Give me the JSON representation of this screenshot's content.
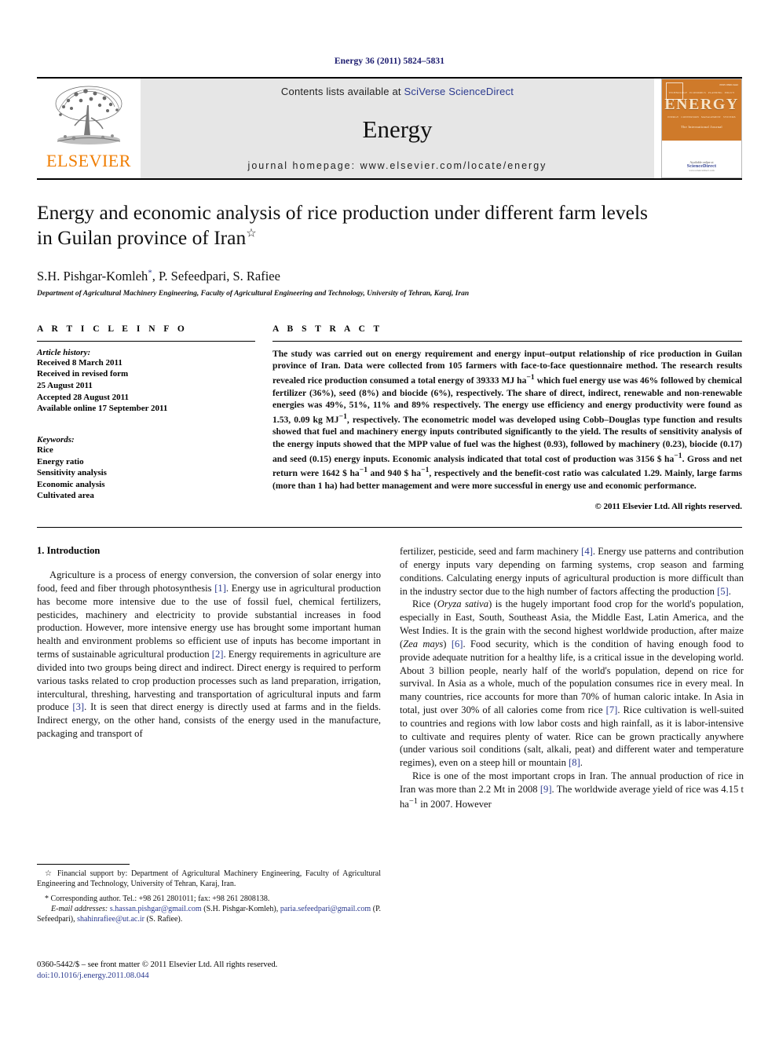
{
  "running_head": "Energy 36 (2011) 5824–5831",
  "header": {
    "publisher_name": "ELSEVIER",
    "contents_prefix": "Contents lists available at ",
    "contents_link": "SciVerse ScienceDirect",
    "journal_name": "Energy",
    "homepage": "journal homepage: www.elsevier.com/locate/energy",
    "cover": {
      "title": "ENERGY",
      "subtitle": "The International Journal",
      "band_terms": [
        "TECHNOLOGY",
        "ECONOMICS",
        "PLANNING",
        "POLICY"
      ],
      "band_terms2": [
        "ENERGY",
        "CONVERSION",
        "MANAGEMENT",
        "SYSTEMS"
      ],
      "available_text": "Available online at",
      "sciencedirect": "ScienceDirect",
      "url": "www.sciencedirect.com",
      "corner_code": "ISSN 0360-5442"
    }
  },
  "article": {
    "title": "Energy and economic analysis of rice production under different farm levels in Guilan province of Iran",
    "title_star": "☆",
    "authors": "S.H. Pishgar-Komleh, P. Sefeedpari, S. Rafiee",
    "author_star": "*",
    "affiliation": "Department of Agricultural Machinery Engineering, Faculty of Agricultural Engineering and Technology, University of Tehran, Karaj, Iran"
  },
  "info": {
    "heading": "A R T I C L E   I N F O",
    "history_label": "Article history:",
    "history": [
      "Received 8 March 2011",
      "Received in revised form",
      "25 August 2011",
      "Accepted 28 August 2011",
      "Available online 17 September 2011"
    ],
    "keywords_label": "Keywords:",
    "keywords": [
      "Rice",
      "Energy ratio",
      "Sensitivity analysis",
      "Economic analysis",
      "Cultivated area"
    ]
  },
  "abstract": {
    "heading": "A B S T R A C T",
    "text": "The study was carried out on energy requirement and energy input–output relationship of rice production in Guilan province of Iran. Data were collected from 105 farmers with face-to-face questionnaire method. The research results revealed rice production consumed a total energy of 39333 MJ ha−1 which fuel energy use was 46% followed by chemical fertilizer (36%), seed (8%) and biocide (6%), respectively. The share of direct, indirect, renewable and non-renewable energies was 49%, 51%, 11% and 89% respectively. The energy use efficiency and energy productivity were found as 1.53, 0.09 kg MJ−1, respectively. The econometric model was developed using Cobb–Douglas type function and results showed that fuel and machinery energy inputs contributed significantly to the yield. The results of sensitivity analysis of the energy inputs showed that the MPP value of fuel was the highest (0.93), followed by machinery (0.23), biocide (0.17) and seed (0.15) energy inputs. Economic analysis indicated that total cost of production was 3156 $ ha−1. Gross and net return were 1642 $ ha−1 and 940 $ ha−1, respectively and the benefit-cost ratio was calculated 1.29. Mainly, large farms (more than 1 ha) had better management and were more successful in energy use and economic performance.",
    "copyright": "© 2011 Elsevier Ltd. All rights reserved."
  },
  "body": {
    "section_number_title": "1.  Introduction",
    "left_paragraph_1": "Agriculture is a process of energy conversion, the conversion of solar energy into food, feed and fiber through photosynthesis [1]. Energy use in agricultural production has become more intensive due to the use of fossil fuel, chemical fertilizers, pesticides, machinery and electricity to provide substantial increases in food production. However, more intensive energy use has brought some important human health and environment problems so efficient use of inputs has become important in terms of sustainable agricultural production [2]. Energy requirements in agriculture are divided into two groups being direct and indirect. Direct energy is required to perform various tasks related to crop production processes such as land preparation, irrigation, intercultural, threshing, harvesting and transportation of agricultural inputs and farm produce [3]. It is seen that direct energy is directly used at farms and in the fields. Indirect energy, on the other hand, consists of the energy used in the manufacture, packaging and transport of",
    "right_paragraph_1": "fertilizer, pesticide, seed and farm machinery [4]. Energy use patterns and contribution of energy inputs vary depending on farming systems, crop season and farming conditions. Calculating energy inputs of agricultural production is more difficult than in the industry sector due to the high number of factors affecting the production [5].",
    "right_paragraph_2": "Rice (Oryza sativa) is the hugely important food crop for the world's population, especially in East, South, Southeast Asia, the Middle East, Latin America, and the West Indies. It is the grain with the second highest worldwide production, after maize (Zea mays) [6]. Food security, which is the condition of having enough food to provide adequate nutrition for a healthy life, is a critical issue in the developing world. About 3 billion people, nearly half of the world's population, depend on rice for survival. In Asia as a whole, much of the population consumes rice in every meal. In many countries, rice accounts for more than 70% of human caloric intake. In Asia in total, just over 30% of all calories come from rice [7]. Rice cultivation is well-suited to countries and regions with low labor costs and high rainfall, as it is labor-intensive to cultivate and requires plenty of water. Rice can be grown practically anywhere (under various soil conditions (salt, alkali, peat) and different water and temperature regimes), even on a steep hill or mountain [8].",
    "right_paragraph_3": "Rice is one of the most important crops in Iran. The annual production of rice in Iran was more than 2.2 Mt in 2008 [9]. The worldwide average yield of rice was 4.15 t ha−1 in 2007. However"
  },
  "footnotes": {
    "funding": "☆ Financial support by: Department of Agricultural Machinery Engineering, Faculty of Agricultural Engineering and Technology, University of Tehran, Karaj, Iran.",
    "corresponding": "* Corresponding author. Tel.: +98 261 2801011; fax: +98 261 2808138.",
    "email_label": "E-mail addresses:",
    "emails": [
      {
        "address": "s.hassan.pishgar@gmail.com",
        "person": "(S.H. Pishgar-Komleh)"
      },
      {
        "address": "paria.sefeedpari@gmail.com",
        "person": "(P. Sefeedpari)"
      },
      {
        "address": "shahinrafiee@ut.ac.ir",
        "person": "(S. Rafiee)."
      }
    ],
    "imprint_line": "0360-5442/$ – see front matter © 2011 Elsevier Ltd. All rights reserved.",
    "doi": "doi:10.1016/j.energy.2011.08.044"
  }
}
